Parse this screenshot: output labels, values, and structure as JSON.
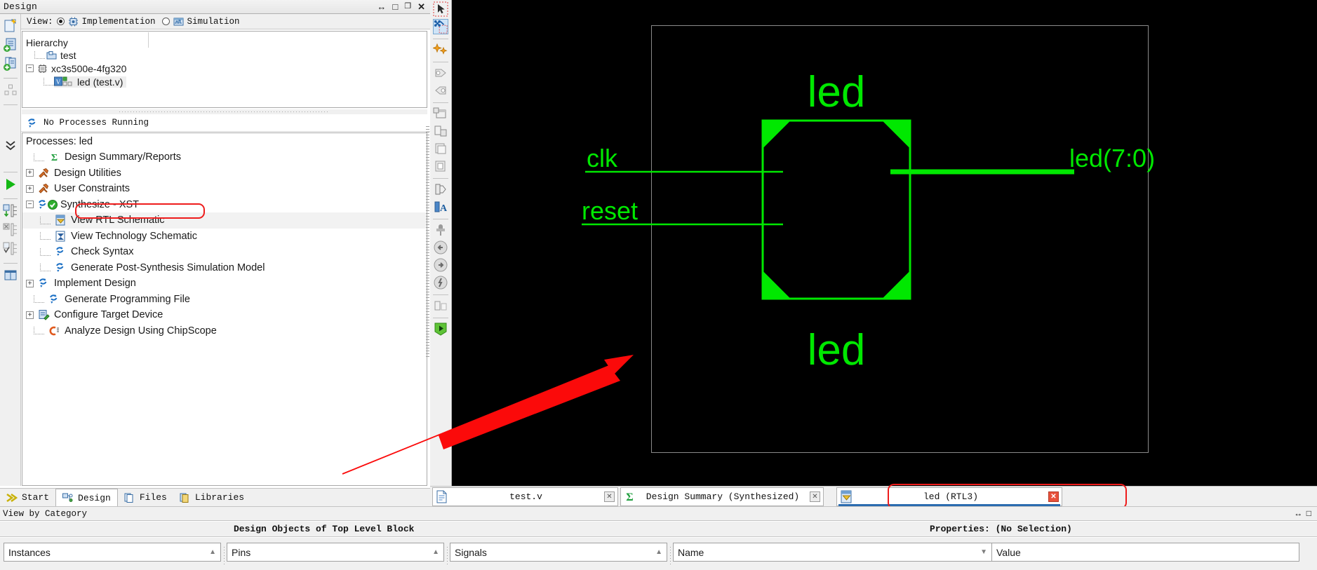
{
  "window": {
    "panel_title": "Design",
    "title_buttons": [
      "float-icon",
      "maximize-icon",
      "restore-icon",
      "close-icon"
    ]
  },
  "view_selector": {
    "label": "View:",
    "options": [
      {
        "label": "Implementation",
        "selected": true,
        "icon": "chip-icon"
      },
      {
        "label": "Simulation",
        "selected": false,
        "icon": "simulation-icon"
      }
    ]
  },
  "hierarchy": {
    "header": "Hierarchy",
    "nodes": [
      {
        "label": "test",
        "icon": "project-icon",
        "indent": 1,
        "expander": "",
        "selected": false
      },
      {
        "label": "xc3s500e-4fg320",
        "icon": "device-icon",
        "indent": 0,
        "expander": "-",
        "selected": false
      },
      {
        "label": "led (test.v)",
        "icon": "verilog-module-icon",
        "indent": 2,
        "expander": "",
        "selected": true
      }
    ]
  },
  "processes": {
    "status": "No Processes Running",
    "status_icon": "refresh-icon",
    "title": "Processes: led",
    "items": [
      {
        "label": "Design Summary/Reports",
        "icon": "sigma-icon",
        "indent": 1,
        "expander": "",
        "selected": false,
        "highlight": false
      },
      {
        "label": "Design Utilities",
        "icon": "tools-icon",
        "indent": 1,
        "expander": "+",
        "selected": false,
        "highlight": false
      },
      {
        "label": "User Constraints",
        "icon": "tools-icon",
        "indent": 1,
        "expander": "+",
        "selected": false,
        "highlight": false
      },
      {
        "label": "Synthesize - XST",
        "icon": "refresh-ok-icon",
        "indent": 1,
        "expander": "-",
        "selected": false,
        "highlight": false
      },
      {
        "label": "View RTL Schematic",
        "icon": "rtl-schematic-icon",
        "indent": 2,
        "expander": "",
        "selected": true,
        "highlight": true
      },
      {
        "label": "View Technology Schematic",
        "icon": "tech-schematic-icon",
        "indent": 2,
        "expander": "",
        "selected": false,
        "highlight": false
      },
      {
        "label": "Check Syntax",
        "icon": "refresh-icon",
        "indent": 2,
        "expander": "",
        "selected": false,
        "highlight": false
      },
      {
        "label": "Generate Post-Synthesis Simulation Model",
        "icon": "refresh-icon",
        "indent": 2,
        "expander": "",
        "selected": false,
        "highlight": false
      },
      {
        "label": "Implement Design",
        "icon": "refresh-icon",
        "indent": 1,
        "expander": "+",
        "selected": false,
        "highlight": false
      },
      {
        "label": "Generate Programming File",
        "icon": "refresh-icon",
        "indent": 1,
        "expander": "",
        "selected": false,
        "highlight": false
      },
      {
        "label": "Configure Target Device",
        "icon": "configure-icon",
        "indent": 1,
        "expander": "+",
        "selected": false,
        "highlight": false
      },
      {
        "label": "Analyze Design Using ChipScope",
        "icon": "chipscope-icon",
        "indent": 1,
        "expander": "",
        "selected": false,
        "highlight": false
      }
    ]
  },
  "view_tabs": [
    {
      "label": "Start",
      "icon": "start-arrow-icon",
      "active": false
    },
    {
      "label": "Design",
      "icon": "design-icon",
      "active": true
    },
    {
      "label": "Files",
      "icon": "files-icon",
      "active": false
    },
    {
      "label": "Libraries",
      "icon": "libraries-icon",
      "active": false
    }
  ],
  "document_tabs": [
    {
      "label": "test.v",
      "icon": "file-icon",
      "active": false,
      "close": "x",
      "close_red": false,
      "highlighted": false
    },
    {
      "label": "Design Summary (Synthesized)",
      "icon": "sigma-icon",
      "active": false,
      "close": "x",
      "close_red": false,
      "highlighted": false
    },
    {
      "label": "led (RTL3)",
      "icon": "rtl-schematic-icon",
      "active": true,
      "close": "x",
      "close_red": true,
      "highlighted": true
    }
  ],
  "schematic": {
    "top_label": "led",
    "bottom_label": "led",
    "inputs": [
      "clk",
      "reset"
    ],
    "outputs": [
      "led(7:0)"
    ],
    "colors": {
      "wire": "#00e800",
      "background": "#000000",
      "page_border": "#8a8a8a"
    }
  },
  "status_strip": {
    "label": "View by Category",
    "buttons": [
      "float-icon",
      "close-icon"
    ]
  },
  "bottom_panel": {
    "objects_title": "Design Objects of Top Level Block",
    "properties_title": "Properties: (No Selection)",
    "combos": [
      {
        "label": "Instances",
        "arrow": "up"
      },
      {
        "label": "Pins",
        "arrow": "up"
      },
      {
        "label": "Signals",
        "arrow": "up"
      },
      {
        "label": "Name",
        "arrow": "down"
      },
      {
        "label": "Value",
        "arrow": ""
      }
    ]
  },
  "annotation": {
    "arrow_color": "#fb0a0a",
    "highlight_color": "#ee1c1c"
  }
}
